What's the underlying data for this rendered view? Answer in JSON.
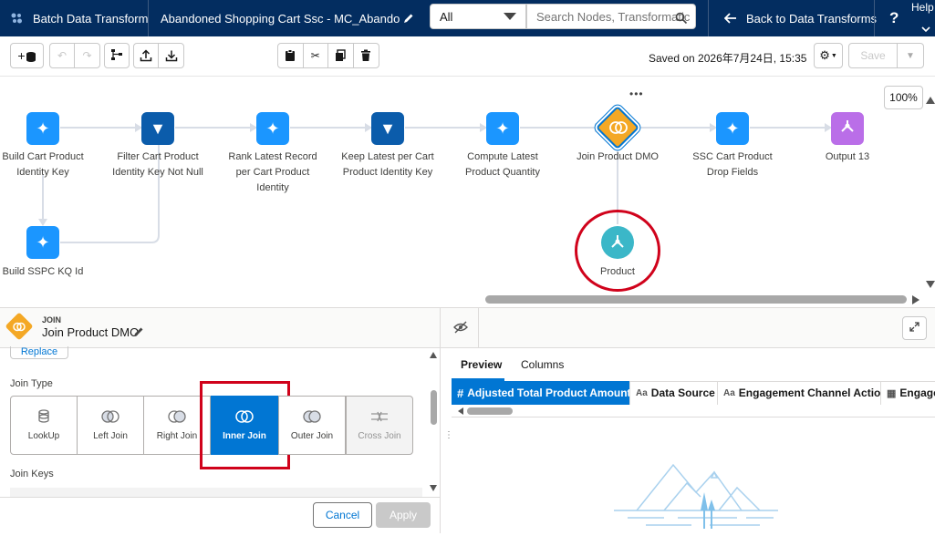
{
  "header": {
    "app_title": "Batch Data Transform",
    "transform_name": "Abandoned Shopping Cart Ssc - MC_Abandoned...",
    "filter_select": "All",
    "search_placeholder": "Search Nodes, Transformatic",
    "back_label": "Back to Data Transforms",
    "help_label": "Help"
  },
  "toolbar": {
    "saved_text": "Saved on 2026年7月24日, 15:35",
    "save_label": "Save",
    "zoom": "100%"
  },
  "nodes": [
    {
      "label1": "Build Cart Product",
      "label2": "Identity Key",
      "type": "transform"
    },
    {
      "label1": "Filter Cart Product",
      "label2": "Identity Key Not Null",
      "type": "filter"
    },
    {
      "label1": "Rank Latest Record",
      "label2": "per Cart Product",
      "label3": "Identity",
      "type": "transform"
    },
    {
      "label1": "Keep Latest per Cart",
      "label2": "Product Identity Key",
      "type": "filter"
    },
    {
      "label1": "Compute Latest",
      "label2": "Product Quantity",
      "type": "transform"
    },
    {
      "label1": "Join Product DMO",
      "type": "join"
    },
    {
      "label1": "SSC Cart Product",
      "label2": "Drop Fields",
      "type": "transform"
    },
    {
      "label1": "Output 13",
      "type": "output"
    },
    {
      "label1": "Build SSPC KQ Id",
      "type": "transform"
    },
    {
      "label1": "Product",
      "type": "input"
    }
  ],
  "panel": {
    "kind": "JOIN",
    "title": "Join Product DMO",
    "replace_label": "Replace",
    "join_type_label": "Join Type",
    "join_types": [
      "LookUp",
      "Left Join",
      "Right Join",
      "Inner Join",
      "Outer Join",
      "Cross Join"
    ],
    "selected_join": "Inner Join",
    "join_keys_label": "Join Keys",
    "cancel_label": "Cancel",
    "apply_label": "Apply"
  },
  "preview": {
    "tabs": [
      "Preview",
      "Columns"
    ],
    "columns": [
      {
        "type": "#",
        "name": "Adjusted Total Product Amount"
      },
      {
        "type": "Aa",
        "name": "Data Source"
      },
      {
        "type": "Aa",
        "name": "Engagement Channel Action"
      },
      {
        "type": "",
        "name": "Engage"
      }
    ]
  },
  "colors": {
    "nav": "#032d60",
    "transform": "#1b96ff",
    "filter": "#0b5cab",
    "join": "#f4a825",
    "output": "#ba6ee8",
    "input": "#3bb7c8",
    "selected": "#0176d3",
    "highlight": "#d0021b"
  }
}
